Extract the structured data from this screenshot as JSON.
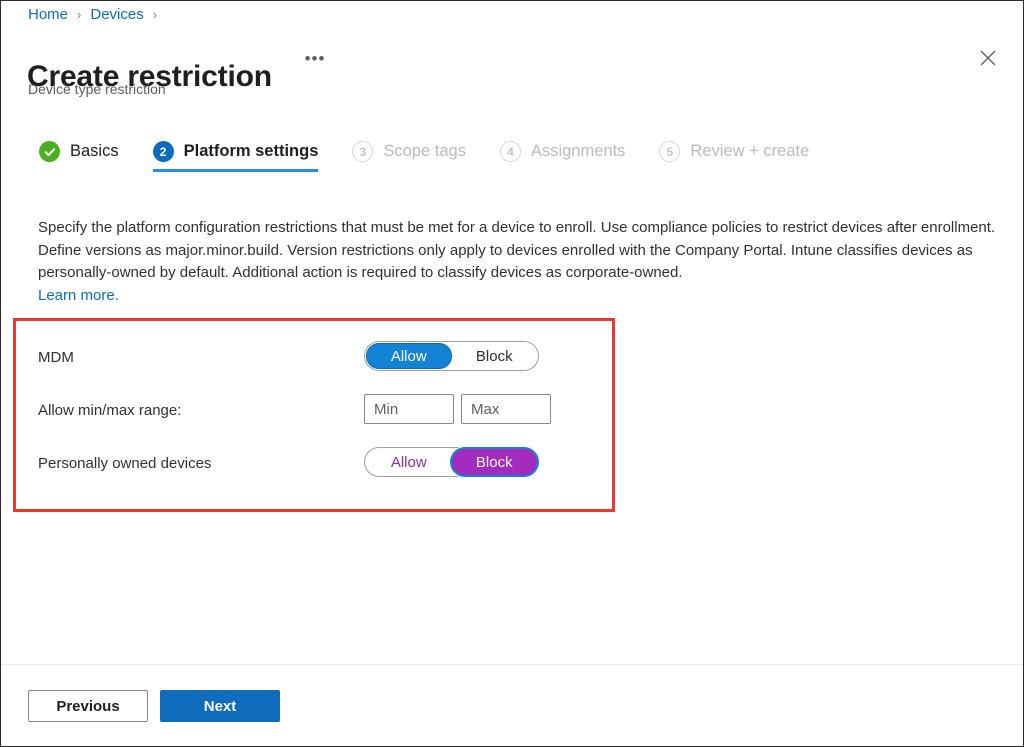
{
  "breadcrumb": {
    "items": [
      {
        "label": "Home"
      },
      {
        "label": "Devices"
      }
    ],
    "separator": "›"
  },
  "header": {
    "title": "Create restriction",
    "subtitle": "Device type restriction",
    "more_actions_glyph": "•••",
    "close_label": "Close"
  },
  "wizard": {
    "steps": [
      {
        "number": "1",
        "label": "Basics",
        "state": "done"
      },
      {
        "number": "2",
        "label": "Platform settings",
        "state": "current"
      },
      {
        "number": "3",
        "label": "Scope tags",
        "state": "upcoming"
      },
      {
        "number": "4",
        "label": "Assignments",
        "state": "upcoming"
      },
      {
        "number": "5",
        "label": "Review + create",
        "state": "upcoming"
      }
    ]
  },
  "description": {
    "body": "Specify the platform configuration restrictions that must be met for a device to enroll. Use compliance policies to restrict devices after enrollment. Define versions as major.minor.build. Version restrictions only apply to devices enrolled with the Company Portal. Intune classifies devices as personally-owned by default. Additional action is required to classify devices as corporate-owned.",
    "link_label": "Learn more."
  },
  "settings": {
    "mdm": {
      "label": "MDM",
      "options": [
        "Allow",
        "Block"
      ],
      "selected": "Allow"
    },
    "range": {
      "label": "Allow min/max range:",
      "min_placeholder": "Min",
      "min_value": "",
      "max_placeholder": "Max",
      "max_value": ""
    },
    "personally_owned": {
      "label": "Personally owned devices",
      "options": [
        "Allow",
        "Block"
      ],
      "selected": "Block"
    }
  },
  "footer": {
    "previous_label": "Previous",
    "next_label": "Next"
  },
  "colors": {
    "accent_blue": "#0f6cbd",
    "toggle_blue": "#1383d6",
    "toggle_purple": "#a32bbd",
    "success_green": "#4caf22",
    "highlight_red": "#e8392f",
    "link_blue": "#0f6cbd"
  }
}
